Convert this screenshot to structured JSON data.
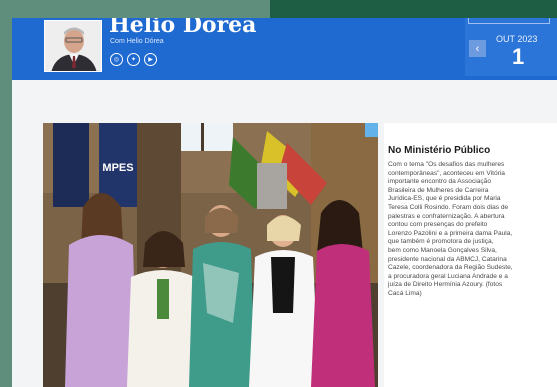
{
  "author": {
    "name": "Helio Dorea",
    "subtitle": "Com Helio Dórea"
  },
  "socials": [
    {
      "icon": "instagram-icon",
      "glyph": "◎"
    },
    {
      "icon": "twitter-icon",
      "glyph": "✦"
    },
    {
      "icon": "youtube-icon",
      "glyph": "▶"
    }
  ],
  "date": {
    "month": "OUT 2023",
    "day": "1",
    "prev_glyph": "‹"
  },
  "photo": {
    "sign_text": "MPES"
  },
  "article": {
    "title": "No Ministério Público",
    "lines": [
      "Com o tema \"Os desafios das mulheres",
      "contemporâneas\", aconteceu em Vitória",
      "importante encontro da Associação",
      "Brasileira de Mulheres de Carreira",
      "Jurídica-ES, que é presidida por Maria",
      "Teresa Colli Rosindo. Foram dois dias de",
      "palestras e confraternização. A abertura",
      "contou com presenças do prefeito",
      "Lorenzo Pazolini e a primeira dama Paula,",
      "que também é promotora de justiça,",
      "bem como Manoela Gonçalves Silva,",
      "presidente nacional da ABMCJ, Catarina",
      "Cazele, coordenadora da Região Sudeste,",
      "a procuradora geral Luciana Andrade e a",
      "juíza de Direito Hermínia Azoury. (fotos",
      "Cacá Lima)"
    ]
  },
  "colors": {
    "header_blue": "#1f6ad0",
    "outer_green": "#5f8f7c",
    "dark_green": "#1d5e45"
  }
}
